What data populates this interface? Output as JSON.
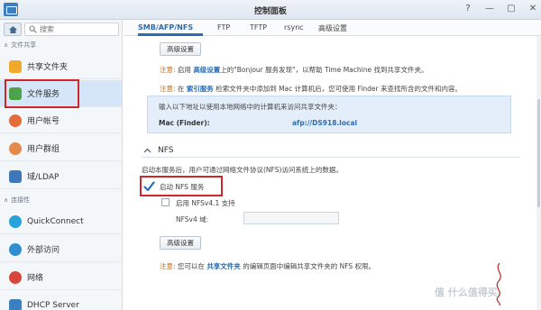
{
  "window": {
    "title": "控制面板",
    "controls": [
      "?",
      "—",
      "▢",
      "✕"
    ]
  },
  "sidebar": {
    "search_placeholder": "搜索",
    "section_file_sharing": "文件共享",
    "section_connectivity": "连接性",
    "items": [
      {
        "label": "共享文件夹",
        "icon": "shared-folder-icon"
      },
      {
        "label": "文件服务",
        "icon": "file-services-icon"
      },
      {
        "label": "用户帐号",
        "icon": "user-icon"
      },
      {
        "label": "用户群组",
        "icon": "group-icon"
      },
      {
        "label": "域/LDAP",
        "icon": "domain-icon"
      },
      {
        "label": "QuickConnect",
        "icon": "quickconnect-icon"
      },
      {
        "label": "外部访问",
        "icon": "external-access-icon"
      },
      {
        "label": "网络",
        "icon": "network-icon"
      },
      {
        "label": "DHCP Server",
        "icon": "dhcp-icon"
      }
    ]
  },
  "tabs": [
    "SMB/AFP/NFS",
    "FTP",
    "TFTP",
    "rsync",
    "高级设置"
  ],
  "afp": {
    "advanced_button": "高级设置",
    "note1_prefix": "注意:",
    "note1_pre": "启用",
    "note1_link": "高级设置",
    "note1_post": "上的\"Bonjour 服务发现\"，以帮助 Time Machine 找到共享文件夹。",
    "note2_prefix": "注意:",
    "note2_pre": "在",
    "note2_link": "索引服务",
    "note2_post": "检索文件夹中添加到 Mac 计算机后，您可使用 Finder 来查找所含的文件和内容。",
    "info_text": "输入以下地址以使用本地网络中的计算机来访问共享文件夹：",
    "mac_label": "Mac (Finder):",
    "mac_value": "afp://DS918.local"
  },
  "nfs": {
    "section_title": "NFS",
    "description": "启动本服务后，用户可通过网络文件协议(NFS)访问系统上的数据。",
    "enable_label": "启动 NFS 服务",
    "enable_checked": true,
    "nfsv41_label": "启用 NFSv4.1 支持",
    "nfsv41_checked": false,
    "domain_label": "NFSv4 域:",
    "domain_value": "",
    "advanced_button": "高级设置",
    "note_prefix": "注意:",
    "note_pre": "您可以在",
    "note_link": "共享文件夹",
    "note_post": "的编辑页面中编辑共享文件夹的 NFS 权限。"
  },
  "watermark": "值 什么值得买",
  "colors": {
    "accent": "#2a6db3",
    "highlight_box": "#d0262b",
    "note_label": "#c06a18"
  }
}
